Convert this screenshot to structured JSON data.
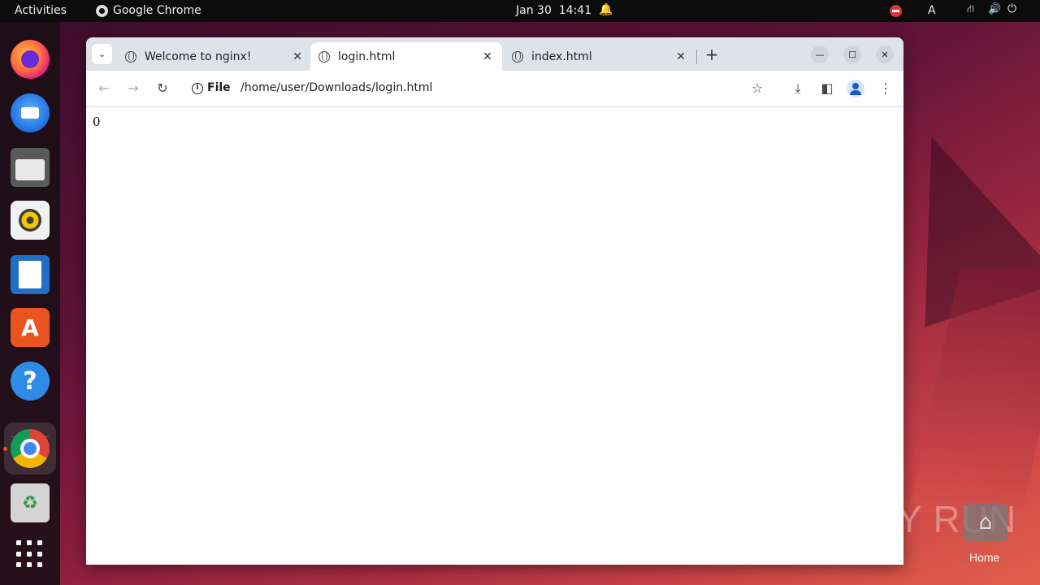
{
  "topbar": {
    "activities": "Activities",
    "app_name": "Google Chrome",
    "date": "Jan 30",
    "time": "14:41",
    "keyboard_layout": "A"
  },
  "dock": {
    "items": [
      "firefox",
      "thunderbird",
      "files",
      "rhythmbox",
      "libreoffice-writer",
      "app-center",
      "help",
      "google-chrome",
      "trash",
      "show-apps"
    ],
    "active": "google-chrome",
    "accent": "#e95420"
  },
  "browser": {
    "tabs": [
      {
        "title": "Welcome to nginx!",
        "active": false
      },
      {
        "title": "login.html",
        "active": true
      },
      {
        "title": "index.html",
        "active": false
      }
    ],
    "toolbar": {
      "scheme": "File",
      "url": "/home/user/Downloads/login.html"
    },
    "content": {
      "text": "0"
    }
  },
  "desktop": {
    "watermark": "ANY RUN",
    "home_label": "Home"
  }
}
